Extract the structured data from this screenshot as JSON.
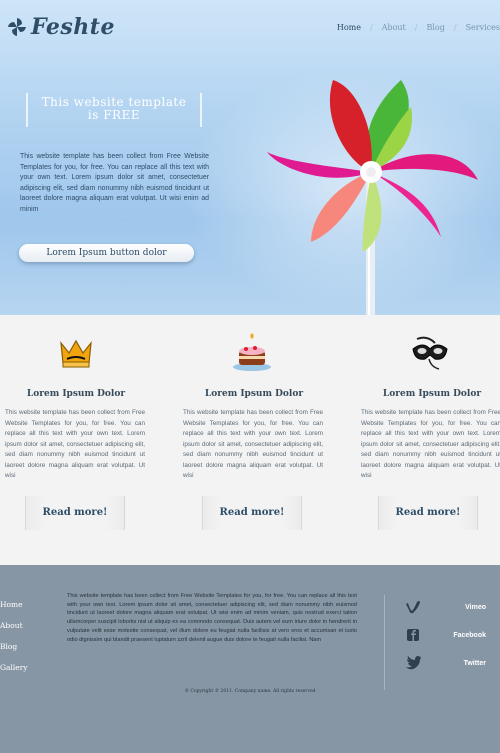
{
  "header": {
    "logo_text": "Feshte",
    "nav": [
      "Home",
      "About",
      "Blog",
      "Services"
    ],
    "nav_separator": "/"
  },
  "hero": {
    "title_line1": "This website template",
    "title_line2": "is FREE",
    "text": "This website template has been collect from Free Website Templates for you, for free. You can replace all this text with your own text. Lorem ipsum dolor sit amet, consectetuer adipiscing elit, sed diam nonummy nibh euismod tincidunt ut laoreet dolore magna aliquam erat volutpat. Ut wisi enim ad minim",
    "button_label": "Lorem Ipsum button dolor"
  },
  "features": [
    {
      "icon": "crown-icon",
      "title": "Lorem Ipsum Dolor",
      "text": "This website template has been collect from Free Website Templates for you, for free. You can replace all this text with your own text. Lorem ipsum dolor sit amet, consectetuer adipiscing elit, sed diam nonummy nibh euismod tincidunt ut laoreet dolore magna aliquam erat volutpat. Ut wisi",
      "button_label": "Read more!"
    },
    {
      "icon": "cake-icon",
      "title": "Lorem Ipsum Dolor",
      "text": "This website template has been collect from Free Website Templates for you, for free. You can replace all this text with your own text. Lorem ipsum dolor sit amet, consectetuer adipiscing elit, sed diam nonummy nibh euismod tincidunt ut laoreet dolore magna aliquam erat volutpat. Ut wisi",
      "button_label": "Read more!"
    },
    {
      "icon": "mask-icon",
      "title": "Lorem Ipsum Dolor",
      "text": "This website template has been collect from Free Website Templates for you, for free. You can replace all this text with your own text. Lorem ipsum dolor sit amet, consectetuer adipiscing elit, sed diam nonummy nibh euismod tincidunt ut laoreet dolore magna aliquam erat volutpat. Ut wisi",
      "button_label": "Read more!"
    }
  ],
  "footer": {
    "nav": [
      "Home",
      "About",
      "Blog",
      "Gallery"
    ],
    "text": "This website template has been collect from Free Website Templates for you, for free. You can replace all this text with your own text. Lorem ipsum dolor sit amet, consectetuer adipiscing elit, sed diam nonummy nibh euismod tincidunt ut laoreet dolore magna aliquam erat volutpat. Ut wisi enim ad minim veniam, quis nostrud exerci tation ullamcorper suscipit lobortis nisl ut aliquip ex ea commodo consequat. Duis autem vel eum iriure dolor in hendrerit in vulputate velit esse molestie consequat, vel illum dolore eu feugiat nulla facilisis at vero eros et accumsan et iusto odio dignissim qui blandit praesent luptatum zzril delenit augue duis dolore te feugait nulla facilisi. Nam",
    "social": [
      {
        "icon": "vimeo-icon",
        "label": "Vimeo"
      },
      {
        "icon": "facebook-icon",
        "label": "Facebook"
      },
      {
        "icon": "twitter-icon",
        "label": "Twitter"
      }
    ],
    "copyright": "© Copyright © 2011. Company name. All rights reserved"
  },
  "colors": {
    "hero_sky": "#b3d4f1",
    "logo": "#2e4d68",
    "features_bg": "#f3f3f3",
    "footer_bg": "#8796a5"
  }
}
